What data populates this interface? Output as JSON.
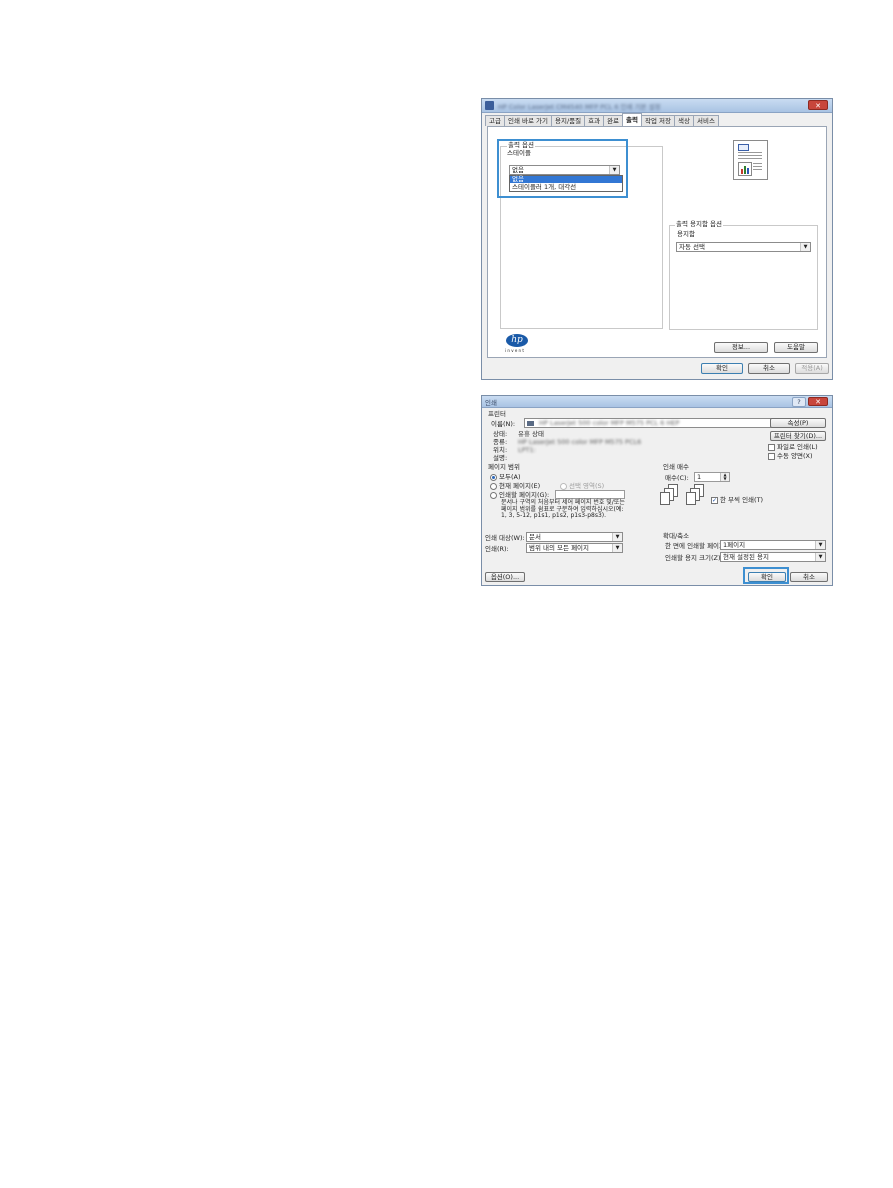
{
  "dialog1": {
    "title": "HP Color LaserJet CM4540 MFP PCL 6 인쇄 기본 설정",
    "close_glyph": "✕",
    "tabs": [
      "고급",
      "인쇄 바로 가기",
      "용지/품질",
      "효과",
      "완료",
      "출력",
      "작업 저장",
      "색상",
      "서비스"
    ],
    "active_tab": "출력",
    "output_options": {
      "group_label": "출력 옵션",
      "stapler_label": "스테이플",
      "selected": "없음",
      "options": [
        "없음",
        "스테이플러 1개, 대각선"
      ]
    },
    "output_bin": {
      "group_label": "출력 용지함 옵션",
      "bin_label": "용지함",
      "selected": "자동 선택"
    },
    "about_button": "정보...",
    "help_button": "도움말",
    "ok_button": "확인",
    "cancel_button": "취소",
    "apply_button": "적용(A)",
    "hp_logo_text": "hp",
    "hp_invent": "i n v e n t"
  },
  "dialog2": {
    "title": "인쇄",
    "help_glyph": "?",
    "close_glyph": "✕",
    "printer_section": "프린터",
    "name_label": "이름(N):",
    "printer_name": "HP LaserJet 500 color MFP M575 PCL 6 HEP",
    "properties_button": "속성(P)",
    "status_label": "상태:",
    "status_value": "유휴 상태",
    "type_label": "종류:",
    "type_value": "HP LaserJet 500 color MFP M575 PCL6",
    "where_label": "위치:",
    "where_value": "LPT1:",
    "comment_label": "설명:",
    "find_printer_button": "프린터 찾기(D)...",
    "print_to_file": "파일로 인쇄(L)",
    "manual_duplex": "수동 양면(X)",
    "page_range_label": "페이지 범위",
    "all_label": "모두(A)",
    "current_page_label": "현재 페이지(E)",
    "selection_label": "선택 영역(S)",
    "pages_label": "인쇄할 페이지(G):",
    "hint_text": "문서나 구역의 처음부터 세어 페이지 번호 및/또는 페이지 범위를 쉼표로 구분하여 입력하십시오(예: 1, 3, 5-12, p1s1, p1s2, p1s3-p8s3).",
    "copies_section": "인쇄 매수",
    "copies_label": "매수(C):",
    "copies_value": "1",
    "collate_label": "한 부씩 인쇄(T)",
    "print_what_label": "인쇄 대상(W):",
    "print_what_value": "문서",
    "print_label": "인쇄(R):",
    "print_value": "범위 내의 모든 페이지",
    "zoom_section": "확대/축소",
    "pages_per_sheet_label": "한 면에 인쇄할 페이지 수(H):",
    "pages_per_sheet_value": "1페이지",
    "scale_label": "인쇄할 용지 크기(Z):",
    "scale_value": "현재 설정된 용지",
    "options_button": "옵션(O)...",
    "ok_button": "확인",
    "cancel_button": "취소"
  }
}
